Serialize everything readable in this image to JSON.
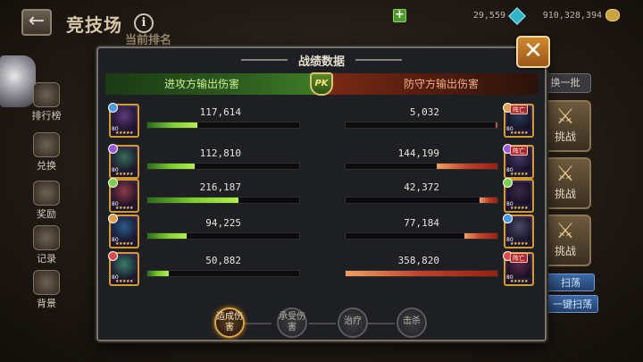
{
  "header": {
    "title": "竞技场",
    "subtitle": "当前排名",
    "currency1": "29,559",
    "currency2": "910,328,394"
  },
  "sidebar": {
    "items": [
      {
        "label": "排行榜",
        "icon": "ranking-icon"
      },
      {
        "label": "兑换",
        "icon": "exchange-icon"
      },
      {
        "label": "奖励",
        "icon": "reward-icon"
      },
      {
        "label": "记录",
        "icon": "record-icon"
      },
      {
        "label": "背景",
        "icon": "background-icon"
      }
    ]
  },
  "right_panel": {
    "refresh": "换一批",
    "challenge": "挑战",
    "sweep": "扫荡",
    "one_click_sweep": "一键扫荡"
  },
  "dialog": {
    "title": "战绩数据",
    "attacker_header": "进攻方输出伤害",
    "defender_header": "防守方输出伤害",
    "pk_badge": "PK",
    "rows": [
      {
        "atk_value": "117,614",
        "atk_fraction": 0.33,
        "def_value": "5,032",
        "def_fraction": 0.014,
        "def_dead": true,
        "atk_level": "80",
        "def_level": "80"
      },
      {
        "atk_value": "112,810",
        "atk_fraction": 0.31,
        "def_value": "144,199",
        "def_fraction": 0.4,
        "def_dead": true,
        "atk_level": "80",
        "def_level": "80"
      },
      {
        "atk_value": "216,187",
        "atk_fraction": 0.6,
        "def_value": "42,372",
        "def_fraction": 0.12,
        "def_dead": false,
        "atk_level": "80",
        "def_level": "80"
      },
      {
        "atk_value": "94,225",
        "atk_fraction": 0.26,
        "def_value": "77,184",
        "def_fraction": 0.22,
        "def_dead": false,
        "atk_level": "80",
        "def_level": "80"
      },
      {
        "atk_value": "50,882",
        "atk_fraction": 0.14,
        "def_value": "358,820",
        "def_fraction": 1.0,
        "def_dead": true,
        "atk_level": "80",
        "def_level": "80"
      }
    ],
    "dead_label": "阵亡",
    "tabs": [
      {
        "label": "造成伤害",
        "active": true
      },
      {
        "label": "承受伤害",
        "active": false
      },
      {
        "label": "治疗",
        "active": false
      },
      {
        "label": "击杀",
        "active": false
      }
    ]
  },
  "colors": {
    "attack_bar": "#7ccd2e",
    "defense_bar": "#c0402a",
    "active_tab": "#e0a640",
    "close_button": "#d28a2e"
  }
}
